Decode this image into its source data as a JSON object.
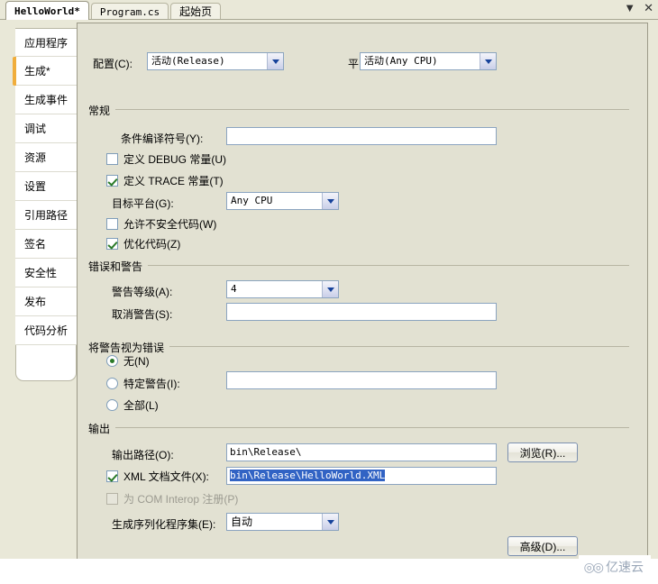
{
  "window": {
    "controls": [
      {
        "name": "tab-list-dropdown",
        "glyph": "▼"
      },
      {
        "name": "close",
        "glyph": "✕"
      }
    ]
  },
  "tabs": [
    {
      "label": "HelloWorld*",
      "active": true,
      "cjk": false
    },
    {
      "label": "Program.cs",
      "active": false,
      "cjk": false
    },
    {
      "label": "起始页",
      "active": false,
      "cjk": true
    }
  ],
  "sidebar": {
    "items": [
      {
        "label": "应用程序",
        "active": false
      },
      {
        "label": "生成*",
        "active": true
      },
      {
        "label": "生成事件",
        "active": false
      },
      {
        "label": "调试",
        "active": false
      },
      {
        "label": "资源",
        "active": false
      },
      {
        "label": "设置",
        "active": false
      },
      {
        "label": "引用路径",
        "active": false
      },
      {
        "label": "签名",
        "active": false
      },
      {
        "label": "安全性",
        "active": false
      },
      {
        "label": "发布",
        "active": false
      },
      {
        "label": "代码分析",
        "active": false
      }
    ]
  },
  "top": {
    "configuration_label": "配置(C):",
    "configuration_value": "活动(Release)",
    "platform_label": "平台(M):",
    "platform_value": "活动(Any CPU)"
  },
  "general": {
    "group_title": "常规",
    "cond_symbols_label": "条件编译符号(Y):",
    "cond_symbols_value": "",
    "define_debug_label": "定义 DEBUG 常量(U)",
    "define_debug_checked": false,
    "define_trace_label": "定义 TRACE 常量(T)",
    "define_trace_checked": true,
    "target_platform_label": "目标平台(G):",
    "target_platform_value": "Any CPU",
    "allow_unsafe_label": "允许不安全代码(W)",
    "allow_unsafe_checked": false,
    "optimize_label": "优化代码(Z)",
    "optimize_checked": true
  },
  "errors_warnings": {
    "group_title": "错误和警告",
    "warning_level_label": "警告等级(A):",
    "warning_level_value": "4",
    "suppress_warnings_label": "取消警告(S):",
    "suppress_warnings_value": ""
  },
  "treat_warnings": {
    "group_title": "将警告视为错误",
    "none_label": "无(N)",
    "specific_label": "特定警告(I):",
    "specific_value": "",
    "all_label": "全部(L)",
    "selected": "none"
  },
  "output": {
    "group_title": "输出",
    "output_path_label": "输出路径(O):",
    "output_path_value": "bin\\Release\\",
    "browse_button": "浏览(R)...",
    "xml_doc_label": "XML 文档文件(X):",
    "xml_doc_checked": true,
    "xml_doc_value": "bin\\Release\\HelloWorld.XML",
    "com_interop_label": "为 COM Interop 注册(P)",
    "com_interop_checked": false,
    "com_interop_disabled": true,
    "gen_serialization_label": "生成序列化程序集(E):",
    "gen_serialization_value": "自动",
    "advanced_button": "高级(D)..."
  },
  "watermark": {
    "logo": "◎◎",
    "text": "亿速云"
  },
  "colors": {
    "window_background": "#e9e8d8",
    "panel_background": "#e2e1d2",
    "sidebar_background": "#ffffff",
    "accent_marker": "#f0ad3c",
    "selection_blue": "#3163c4",
    "field_border": "#8ba4c0"
  }
}
